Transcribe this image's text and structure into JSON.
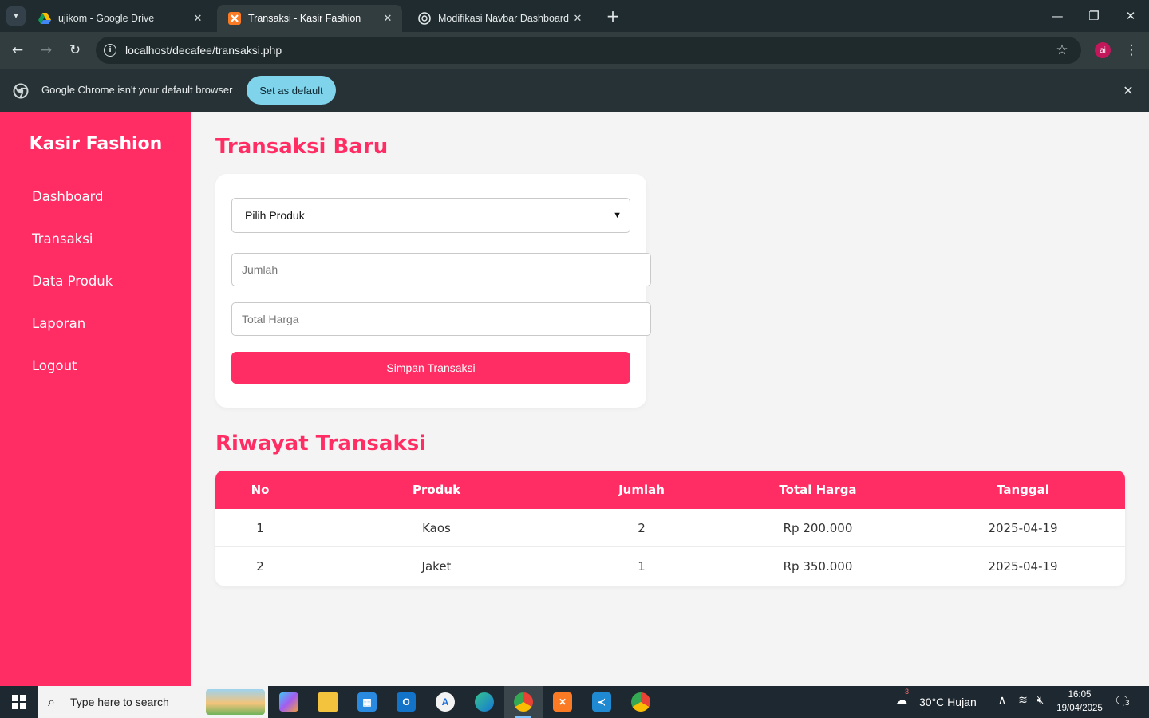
{
  "browser": {
    "tabs": [
      {
        "title": "ujikom - Google Drive",
        "favicon": "google-drive-icon",
        "active": false
      },
      {
        "title": "Transaksi - Kasir Fashion",
        "favicon": "xampp-icon",
        "active": true
      },
      {
        "title": "Modifikasi Navbar Dashboard",
        "favicon": "chatgpt-icon",
        "active": false
      }
    ],
    "url": "localhost/decafee/transaksi.php",
    "profile_initials": "ai",
    "infobar": {
      "message": "Google Chrome isn't your default browser",
      "button": "Set as default"
    }
  },
  "sidebar": {
    "brand": "Kasir Fashion",
    "items": [
      {
        "label": "Dashboard"
      },
      {
        "label": "Transaksi"
      },
      {
        "label": "Data Produk"
      },
      {
        "label": "Laporan"
      },
      {
        "label": "Logout"
      }
    ]
  },
  "form": {
    "title": "Transaksi Baru",
    "product_select": "Pilih Produk",
    "qty_placeholder": "Jumlah",
    "total_placeholder": "Total Harga",
    "submit": "Simpan Transaksi"
  },
  "history": {
    "title": "Riwayat Transaksi",
    "columns": [
      "No",
      "Produk",
      "Jumlah",
      "Total Harga",
      "Tanggal"
    ],
    "rows": [
      [
        "1",
        "Kaos",
        "2",
        "Rp 200.000",
        "2025-04-19"
      ],
      [
        "2",
        "Jaket",
        "1",
        "Rp 350.000",
        "2025-04-19"
      ]
    ]
  },
  "taskbar": {
    "search_placeholder": "Type here to search",
    "weather": "30°C  Hujan",
    "weather_badge": "3",
    "time": "16:05",
    "date": "19/04/2025",
    "notification_count": "3"
  },
  "colors": {
    "accent": "#ff2d64",
    "page_bg": "#f4f4f4",
    "chrome_dark": "#1f2b2e",
    "infobar_button": "#7fd3ea"
  }
}
